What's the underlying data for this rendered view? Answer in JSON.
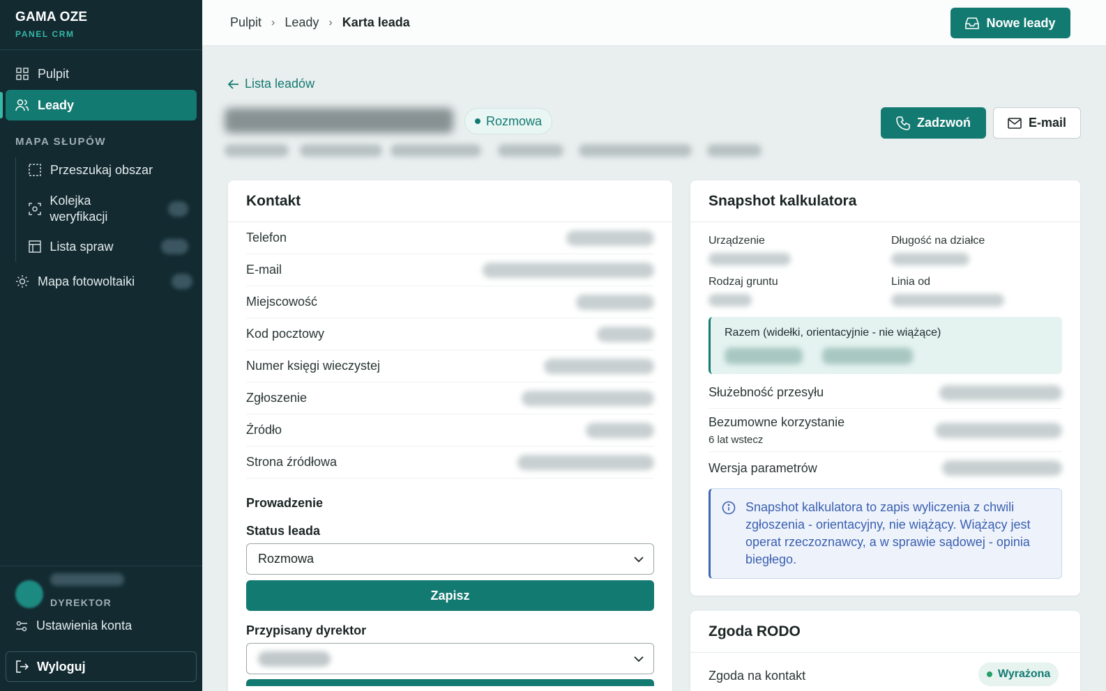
{
  "app": {
    "title": "GAMA OZE",
    "subtitle": "PANEL CRM"
  },
  "sidebar": {
    "items": [
      {
        "label": "Pulpit",
        "icon": "grid-icon"
      },
      {
        "label": "Leady",
        "icon": "users-icon"
      }
    ],
    "section_label": "MAPA SŁUPÓW",
    "sub_items": [
      {
        "label": "Przeszukaj obszar",
        "icon": "select-area-icon"
      },
      {
        "label": "Kolejka weryfikacji",
        "icon": "scan-icon"
      },
      {
        "label": "Lista spraw",
        "icon": "table-icon"
      }
    ],
    "extra_item": {
      "label": "Mapa fotowoltaiki",
      "icon": "sun-icon"
    },
    "user": {
      "role": "DYREKTOR"
    },
    "settings_label": "Ustawienia konta",
    "logout_label": "Wyloguj"
  },
  "topbar": {
    "breadcrumbs": [
      "Pulpit",
      "Leady",
      "Karta leada"
    ],
    "new_leads_label": "Nowe leady"
  },
  "lead": {
    "back_label": "Lista leadów",
    "status": "Rozmowa",
    "call_label": "Zadzwoń",
    "email_label": "E-mail"
  },
  "contact": {
    "title": "Kontakt",
    "rows": [
      "Telefon",
      "E-mail",
      "Miejscowość",
      "Kod pocztowy",
      "Numer księgi wieczystej",
      "Zgłoszenie",
      "Źródło",
      "Strona źródłowa"
    ],
    "section": "Prowadzenie",
    "status_label": "Status leada",
    "status_value": "Rozmowa",
    "save_label": "Zapisz",
    "director_label": "Przypisany dyrektor"
  },
  "snapshot": {
    "title": "Snapshot kalkulatora",
    "fields": [
      "Urządzenie",
      "Długość na działce",
      "Rodzaj gruntu",
      "Linia od"
    ],
    "range_label": "Razem (widełki, orientacyjnie - nie wiążące)",
    "rows": [
      {
        "label": "Służebność przesyłu",
        "sub": ""
      },
      {
        "label": "Bezumowne korzystanie",
        "sub": "6 lat wstecz"
      },
      {
        "label": "Wersja parametrów",
        "sub": ""
      }
    ],
    "info": "Snapshot kalkulatora to zapis wyliczenia z chwili zgłoszenia - orientacyjny, nie wiążący. Wiążący jest operat rzeczoznawcy, a w sprawie sądowej - opinia biegłego."
  },
  "rodo": {
    "title": "Zgoda RODO",
    "consent_label": "Zgoda na kontakt",
    "consent_status": "Wyrażona"
  },
  "colors": {
    "accent": "#137a72",
    "sidebar": "#132a31",
    "info": "#3d64b5"
  }
}
